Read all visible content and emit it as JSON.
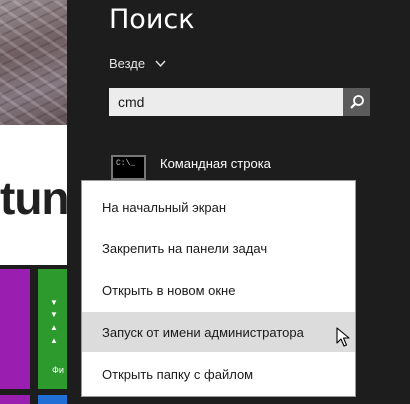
{
  "background": {
    "logo_text": "tune",
    "tile_label": "Фи",
    "tile_arrows": [
      "▼",
      "▼",
      "▲",
      "▲"
    ]
  },
  "search_panel": {
    "title": "Поиск",
    "scope_label": "Везде",
    "query": "cmd",
    "result": {
      "icon_text": "C:\\_",
      "label": "Командная строка"
    }
  },
  "context_menu": {
    "items": [
      {
        "label": "На начальный экран"
      },
      {
        "label": "Закрепить на панели задач"
      },
      {
        "label": "Открыть в новом окне"
      },
      {
        "label": "Запуск от имени администратора",
        "state": "hover"
      },
      {
        "label": "Открыть папку с файлом"
      }
    ]
  },
  "colors": {
    "panel_bg": "#1d1d1d",
    "search_button": "#5b5b5b",
    "menu_hover": "#dcdcdc",
    "tile_purple": "#9a1fb0",
    "tile_green": "#2c9a2c"
  }
}
